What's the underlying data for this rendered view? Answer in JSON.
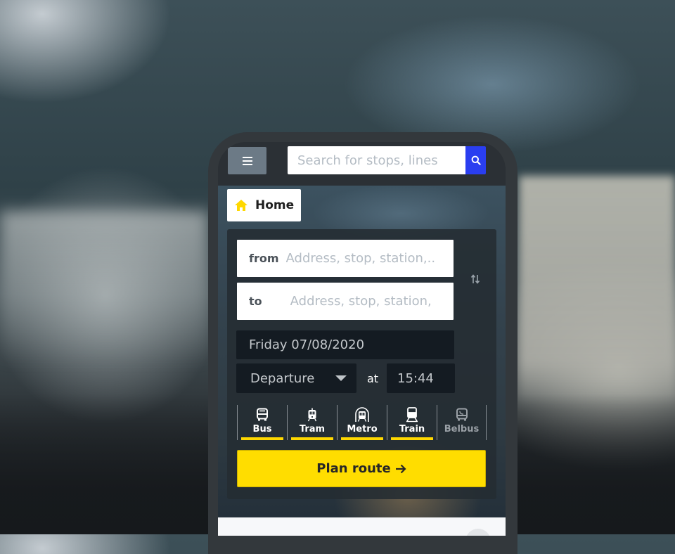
{
  "header": {
    "menu_icon": "hamburger-icon",
    "search": {
      "placeholder": "Search for stops, lines",
      "value": "",
      "button_icon": "search-icon"
    },
    "colors": {
      "search_button": "#2a3ef0",
      "menu_button": "#6c7a86"
    }
  },
  "breadcrumb": {
    "icon": "home-icon",
    "label": "Home",
    "icon_color": "#ffd800"
  },
  "planner": {
    "from": {
      "label": "from",
      "placeholder": "Address, stop, station,..",
      "value": ""
    },
    "to": {
      "label": "to",
      "placeholder": "Address, stop, station,",
      "value": ""
    },
    "swap_icon": "swap-vertical-icon",
    "date": "Friday 07/08/2020",
    "mode": {
      "selected": "Departure"
    },
    "at_label": "at",
    "time": "15:44",
    "transport_modes": [
      {
        "label": "Bus",
        "icon": "bus-icon",
        "selected": true
      },
      {
        "label": "Tram",
        "icon": "tram-icon",
        "selected": true
      },
      {
        "label": "Metro",
        "icon": "metro-icon",
        "selected": true
      },
      {
        "label": "Train",
        "icon": "train-icon",
        "selected": true
      },
      {
        "label": "Belbus",
        "icon": "belbus-icon",
        "selected": false
      }
    ],
    "plan_button": {
      "label": "Plan route",
      "icon": "arrow-right-icon"
    },
    "colors": {
      "accent": "#ffdd00"
    }
  }
}
